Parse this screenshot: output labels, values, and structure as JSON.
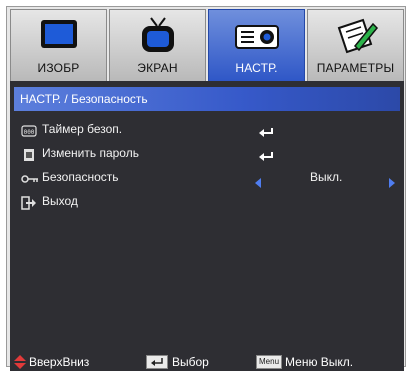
{
  "tabs": [
    {
      "label": "ИЗОБР",
      "icon": "monitor-icon",
      "active": false
    },
    {
      "label": "ЭКРАН",
      "icon": "tv-icon",
      "active": false
    },
    {
      "label": "НАСТР.",
      "icon": "projector-icon",
      "active": true
    },
    {
      "label": "ПАРАМЕТРЫ",
      "icon": "pencil-note-icon",
      "active": false
    }
  ],
  "panel": {
    "title": "НАСТР. / Безопасность",
    "items": [
      {
        "label": "Таймер безоп.",
        "icon": "timer-icon",
        "value": "",
        "has_enter": true
      },
      {
        "label": "Изменить пароль",
        "icon": "keypad-icon",
        "value": "",
        "has_enter": true
      },
      {
        "label": "Безопасность",
        "icon": "key-icon",
        "value": "Выкл.",
        "has_enter": false
      },
      {
        "label": "Выход",
        "icon": "exit-icon",
        "value": "",
        "has_enter": false
      }
    ]
  },
  "footer": {
    "nav_label": "ВверхВниз",
    "select_label": "Выбор",
    "menu_key": "Menu",
    "menu_label": "Меню Выкл."
  },
  "colors": {
    "active_tab": "#3a5fcf",
    "panel_bg": "#2e2e33",
    "accent_arrow": "#4f7df0",
    "nav_arrow": "#e23a3a"
  }
}
